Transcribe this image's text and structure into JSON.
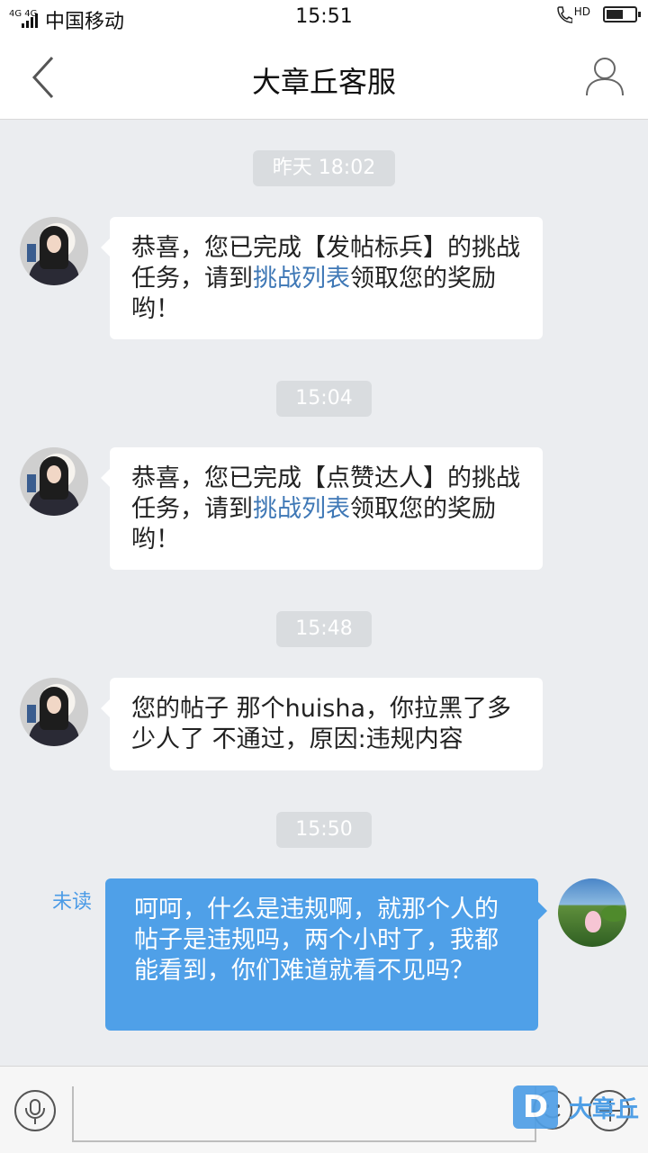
{
  "status_bar": {
    "network": "4G 4G",
    "carrier": "中国移动",
    "time": "15:51",
    "call_hd": "HD",
    "battery_level": 0.6
  },
  "header": {
    "title": "大章丘客服"
  },
  "messages": [
    {
      "time": "昨天 18:02",
      "side": "left",
      "text_pre": "恭喜，您已完成【发帖标兵】的挑战任务，请到",
      "link": "挑战列表",
      "text_post": "领取您的奖励哟！"
    },
    {
      "time": "15:04",
      "side": "left",
      "text_pre": "恭喜，您已完成【点赞达人】的挑战任务，请到",
      "link": "挑战列表",
      "text_post": "领取您的奖励哟！"
    },
    {
      "time": "15:48",
      "side": "left",
      "text": "您的帖子 那个huisha，你拉黑了多少人了 不通过，原因:违规内容"
    },
    {
      "time": "15:50",
      "side": "right",
      "text": "呵呵，什么是违规啊，就那个人的帖子是违规吗，两个小时了，我都能看到，你们难道就看不见吗？",
      "status": "未读"
    }
  ],
  "input_bar": {
    "placeholder": ""
  },
  "watermark": {
    "badge": "D",
    "text": "大章丘"
  },
  "colors": {
    "link": "#3f78b6",
    "outgoing_bubble": "#4fa0e8",
    "background": "#ebedf0"
  }
}
